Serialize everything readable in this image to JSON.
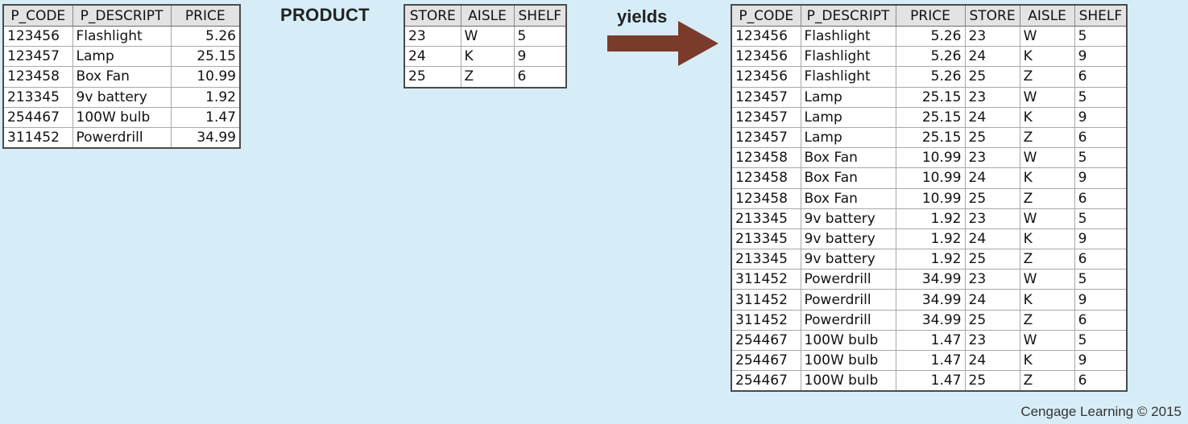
{
  "labels": {
    "product": "PRODUCT",
    "yields": "yields",
    "credit": "Cengage Learning © 2015"
  },
  "colors": {
    "background": "#d6edf7",
    "arrow": "#7b3b2a",
    "header": "#e3e3e3"
  },
  "icons": {
    "arrow": "right-arrow-icon"
  },
  "tables": {
    "product": {
      "columns": [
        "P_CODE",
        "P_DESCRIPT",
        "PRICE"
      ],
      "rows": [
        [
          "123456",
          "Flashlight",
          "5.26"
        ],
        [
          "123457",
          "Lamp",
          "25.15"
        ],
        [
          "123458",
          "Box Fan",
          "10.99"
        ],
        [
          "213345",
          "9v battery",
          "1.92"
        ],
        [
          "254467",
          "100W bulb",
          "1.47"
        ],
        [
          "311452",
          "Powerdrill",
          "34.99"
        ]
      ]
    },
    "vendor": {
      "columns": [
        "STORE",
        "AISLE",
        "SHELF"
      ],
      "rows": [
        [
          "23",
          "W",
          "5"
        ],
        [
          "24",
          "K",
          "9"
        ],
        [
          "25",
          "Z",
          "6"
        ]
      ]
    },
    "result": {
      "columns": [
        "P_CODE",
        "P_DESCRIPT",
        "PRICE",
        "STORE",
        "AISLE",
        "SHELF"
      ],
      "rows": [
        [
          "123456",
          "Flashlight",
          "5.26",
          "23",
          "W",
          "5"
        ],
        [
          "123456",
          "Flashlight",
          "5.26",
          "24",
          "K",
          "9"
        ],
        [
          "123456",
          "Flashlight",
          "5.26",
          "25",
          "Z",
          "6"
        ],
        [
          "123457",
          "Lamp",
          "25.15",
          "23",
          "W",
          "5"
        ],
        [
          "123457",
          "Lamp",
          "25.15",
          "24",
          "K",
          "9"
        ],
        [
          "123457",
          "Lamp",
          "25.15",
          "25",
          "Z",
          "6"
        ],
        [
          "123458",
          "Box Fan",
          "10.99",
          "23",
          "W",
          "5"
        ],
        [
          "123458",
          "Box Fan",
          "10.99",
          "24",
          "K",
          "9"
        ],
        [
          "123458",
          "Box Fan",
          "10.99",
          "25",
          "Z",
          "6"
        ],
        [
          "213345",
          "9v battery",
          "1.92",
          "23",
          "W",
          "5"
        ],
        [
          "213345",
          "9v battery",
          "1.92",
          "24",
          "K",
          "9"
        ],
        [
          "213345",
          "9v battery",
          "1.92",
          "25",
          "Z",
          "6"
        ],
        [
          "311452",
          "Powerdrill",
          "34.99",
          "23",
          "W",
          "5"
        ],
        [
          "311452",
          "Powerdrill",
          "34.99",
          "24",
          "K",
          "9"
        ],
        [
          "311452",
          "Powerdrill",
          "34.99",
          "25",
          "Z",
          "6"
        ],
        [
          "254467",
          "100W bulb",
          "1.47",
          "23",
          "W",
          "5"
        ],
        [
          "254467",
          "100W bulb",
          "1.47",
          "24",
          "K",
          "9"
        ],
        [
          "254467",
          "100W bulb",
          "1.47",
          "25",
          "Z",
          "6"
        ]
      ]
    }
  }
}
